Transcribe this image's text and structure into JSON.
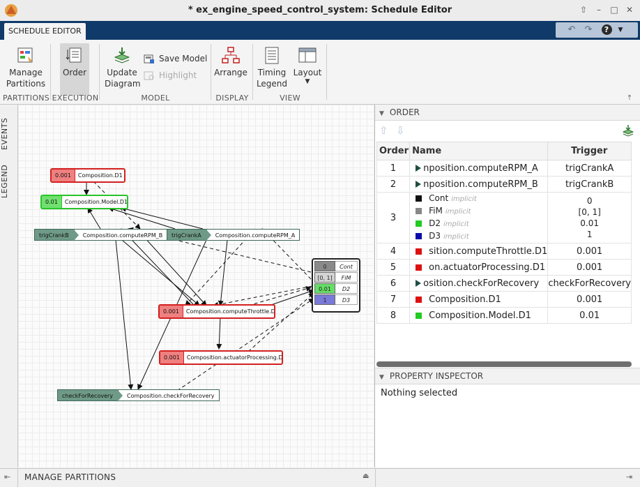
{
  "window": {
    "title": "* ex_engine_speed_control_system: Schedule Editor"
  },
  "toolstrip": {
    "tab_label": "SCHEDULE EDITOR"
  },
  "ribbon": {
    "groups": {
      "partitions": "PARTITIONS",
      "execution": "EXECUTION",
      "model": "MODEL",
      "display": "DISPLAY",
      "view": "VIEW"
    },
    "buttons": {
      "manage_partitions_1": "Manage",
      "manage_partitions_2": "Partitions",
      "order": "Order",
      "update_diagram_1": "Update",
      "update_diagram_2": "Diagram",
      "save_model": "Save Model",
      "highlight": "Highlight",
      "arrange": "Arrange",
      "timing_legend_1": "Timing",
      "timing_legend_2": "Legend",
      "layout": "Layout"
    }
  },
  "side_tabs": {
    "events": "EVENTS",
    "legend": "LEGEND"
  },
  "graph": {
    "nodes": {
      "comp_d1": {
        "rate": "0.001",
        "name": "Composition.D1"
      },
      "model_d1": {
        "rate": "0.01",
        "name": "Composition.Model.D1"
      },
      "rpm_b": {
        "trigger": "trigCrankB",
        "name": "Composition.computeRPM_B"
      },
      "rpm_a": {
        "trigger": "trigCrankA",
        "name": "Composition.computeRPM_A"
      },
      "throttle": {
        "rate": "0.001",
        "name": "Composition.computeThrottle.D1"
      },
      "actuator": {
        "rate": "0.001",
        "name": "Composition.actuatorProcessing.D1"
      },
      "recovery": {
        "trigger": "checkForRecovery",
        "name": "Composition.checkForRecovery"
      }
    },
    "legend": [
      {
        "value": "0",
        "name": "Cont",
        "color": "#8a8a8a"
      },
      {
        "value": "[0, 1]",
        "name": "FiM",
        "color": "#d4d4d4"
      },
      {
        "value": "0.01",
        "name": "D2",
        "color": "#66dd66"
      },
      {
        "value": "1",
        "name": "D3",
        "color": "#7a7ad8"
      }
    ]
  },
  "order_panel": {
    "title": "ORDER",
    "columns": {
      "order": "Order",
      "name": "Name",
      "trigger": "Trigger"
    },
    "rows": [
      {
        "order": "1",
        "kind": "event",
        "name": "nposition.computeRPM_A",
        "trigger": "trigCrankA"
      },
      {
        "order": "2",
        "kind": "event",
        "name": "nposition.computeRPM_B",
        "trigger": "trigCrankB"
      },
      {
        "order": "4",
        "kind": "red",
        "name": "sition.computeThrottle.D1",
        "trigger": "0.001"
      },
      {
        "order": "5",
        "kind": "red",
        "name": "on.actuatorProcessing.D1",
        "trigger": "0.001"
      },
      {
        "order": "6",
        "kind": "event",
        "name": "osition.checkForRecovery",
        "trigger": "checkForRecovery"
      },
      {
        "order": "7",
        "kind": "red",
        "name": "Composition.D1",
        "trigger": "0.001"
      },
      {
        "order": "8",
        "kind": "green",
        "name": "Composition.Model.D1",
        "trigger": "0.01"
      }
    ],
    "row3": {
      "order": "3",
      "implicit_label": "implicit",
      "items": [
        {
          "name": "Cont",
          "trigger": "0",
          "color": "#111111"
        },
        {
          "name": "FiM",
          "trigger": "[0, 1]",
          "color": "#888888"
        },
        {
          "name": "D2",
          "trigger": "0.01",
          "color": "#22cc22"
        },
        {
          "name": "D3",
          "trigger": "1",
          "color": "#0a0aaa"
        }
      ]
    }
  },
  "property_inspector": {
    "title": "PROPERTY INSPECTOR",
    "empty_text": "Nothing selected"
  },
  "bottom": {
    "manage_partitions": "MANAGE PARTITIONS"
  }
}
